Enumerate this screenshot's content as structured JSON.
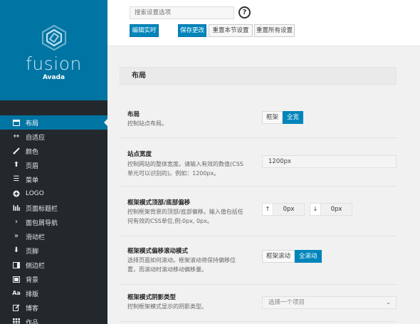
{
  "sidebar": {
    "logo_word": "fusion",
    "logo_sub": "Avada",
    "items": [
      {
        "label": "布局",
        "icon": "layout-icon",
        "active": true
      },
      {
        "label": "自适应",
        "icon": "arrows-horizontal-icon"
      },
      {
        "label": "颜色",
        "icon": "brush-icon"
      },
      {
        "label": "页眉",
        "icon": "arrow-up-icon"
      },
      {
        "label": "菜单",
        "icon": "menu-icon"
      },
      {
        "label": "LOGO",
        "icon": "plus-circle-icon"
      },
      {
        "label": "页面标题栏",
        "icon": "bars-icon"
      },
      {
        "label": "面包屑导航",
        "icon": "chevron-right-icon"
      },
      {
        "label": "滑动栏",
        "icon": "chevron-double-right-icon"
      },
      {
        "label": "页脚",
        "icon": "arrow-down-icon"
      },
      {
        "label": "侧边栏",
        "icon": "sidebar-panel-icon"
      },
      {
        "label": "背景",
        "icon": "background-icon"
      },
      {
        "label": "排版",
        "icon": "typography-icon"
      },
      {
        "label": "博客",
        "icon": "blog-edit-icon"
      },
      {
        "label": "作品",
        "icon": "grid-icon"
      }
    ]
  },
  "topbar": {
    "search_placeholder": "搜索设置选项",
    "help_glyph": "?",
    "edit_live": "编辑实时",
    "save_changes": "保存更改",
    "reset_section": "重置本节设置",
    "reset_all": "重置所有设置"
  },
  "section_title": "布局",
  "settings": {
    "layout": {
      "title": "布局",
      "desc": "控制站点布局。",
      "options": [
        "框架",
        "全宽"
      ],
      "selected": "全宽"
    },
    "site_width": {
      "title": "站点宽度",
      "desc": "控制网站的整体宽度。请输入有效的数值(CSS单元可以识别的)。例如：1200px。",
      "value": "1200px"
    },
    "boxed_offset": {
      "title": "框架模式顶部/底部偏移",
      "desc": "控制框架背景的顶部/底部偏移。输入值包括任何有效的CSS单位,例:0px, 0px。",
      "top_arrow": "↑",
      "top_value": "0px",
      "bottom_arrow": "↓",
      "bottom_value": "0px"
    },
    "boxed_scroll": {
      "title": "框架模式偏移滚动模式",
      "desc": "选择页面如何滚动。框架滚动将保持偏移位置，而滚动时滚动移动偏移量。",
      "options": [
        "框架滚动",
        "全滚动"
      ],
      "selected": "全滚动"
    },
    "boxed_shadow": {
      "title": "框架模式阴影类型",
      "desc": "控制框架模式显示的阴影类型。",
      "placeholder": "选择一个项目",
      "chevron": "⌄"
    }
  }
}
